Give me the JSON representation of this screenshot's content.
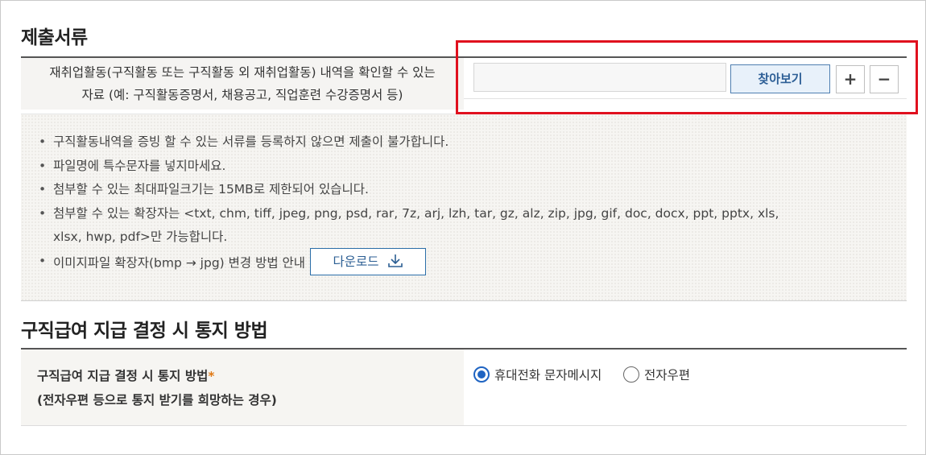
{
  "documents": {
    "title": "제출서류",
    "label_line1": "재취업활동(구직활동 또는 구직활동 외 재취업활동) 내역을 확인할 수 있는",
    "label_line2": "자료 (예: 구직활동증명서, 채용공고, 직업훈련 수강증명서 등)",
    "file_value": "",
    "browse_label": "찾아보기",
    "add_label": "+",
    "remove_label": "−"
  },
  "notice": {
    "items": [
      "구직활동내역을 증빙 할 수 있는 서류를 등록하지 않으면 제출이 불가합니다.",
      "파일명에 특수문자를 넣지마세요.",
      "첨부할 수 있는 최대파일크기는 15MB로 제한되어 있습니다.",
      "첨부할 수 있는 확장자는 <txt, chm, tiff, jpeg, png, psd, rar, 7z, arj, lzh, tar, gz, alz, zip, jpg, gif, doc, docx, ppt, pptx, xls, xlsx, hwp, pdf>만 가능합니다.",
      "이미지파일 확장자(bmp → jpg) 변경 방법 안내"
    ],
    "download_label": "다운로드"
  },
  "notification": {
    "title": "구직급여 지급 결정 시 통지 방법",
    "label": "구직급여 지급 결정 시 통지 방법",
    "required_mark": "*",
    "sub_label": "(전자우편 등으로 통지 받기를 희망하는 경우)",
    "options": [
      {
        "label": "휴대전화 문자메시지",
        "selected": true
      },
      {
        "label": "전자우편",
        "selected": false
      }
    ]
  },
  "colors": {
    "highlight": "#e0101e",
    "accent": "#1f64c2",
    "required": "#e07a16"
  },
  "icons": [
    "download-icon",
    "plus-icon",
    "minus-icon"
  ]
}
